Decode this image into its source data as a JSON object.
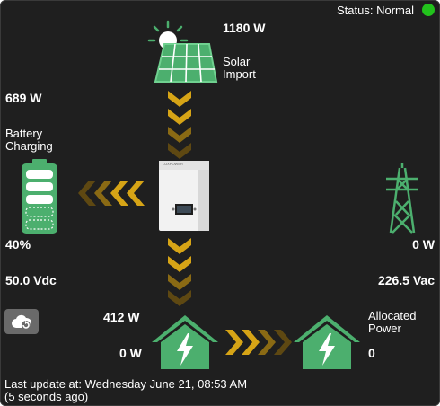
{
  "status": {
    "label": "Status: Normal",
    "color": "#22c21c"
  },
  "solar": {
    "power": "1180 W",
    "label_line1": "Solar",
    "label_line2": "Import"
  },
  "battery": {
    "power": "689 W",
    "label_line1": "Battery",
    "label_line2": "Charging",
    "soc": "40%",
    "voltage": "50.0 Vdc",
    "soc_value": 0.4
  },
  "grid": {
    "power": "0 W",
    "voltage": "226.5 Vac"
  },
  "load": {
    "power": "412 W",
    "secondary_power": "0 W"
  },
  "allocated": {
    "label_line1": "Allocated",
    "label_line2": "Power",
    "value": "0"
  },
  "inverter": {
    "brand": "LUXPOWER"
  },
  "footer": {
    "line1": "Last update at: Wednesday June 21, 08:53 AM",
    "line2": "(5 seconds ago)"
  },
  "colors": {
    "accent_green": "#4caf6e",
    "arrow_gold": "#d6a416",
    "arrow_dim": "#6e5518",
    "background": "#1f1f1f"
  },
  "icons": [
    "sun-icon",
    "solar-panel-icon",
    "battery-icon",
    "inverter-icon",
    "transmission-tower-icon",
    "house-icon",
    "cloud-refresh-icon",
    "status-dot-icon"
  ]
}
